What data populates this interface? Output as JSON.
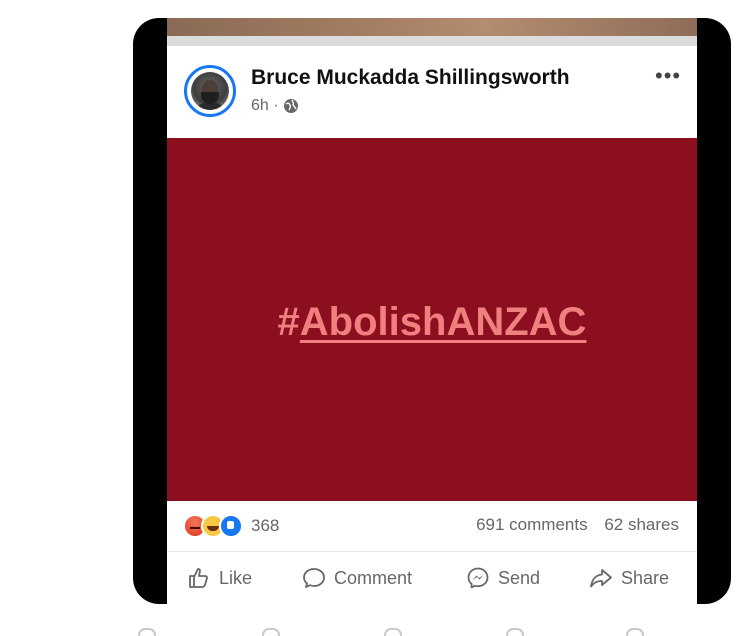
{
  "post": {
    "author": "Bruce Muckadda Shillingsworth",
    "time": "6h ·",
    "hashtag": "#AbolishANZAC",
    "hashtag_symbol": "#",
    "hashtag_text": "AbolishANZAC",
    "banner_color": "#8b0f1e",
    "hashtag_color": "#f08080",
    "more_label": "•••"
  },
  "stats": {
    "reactions_count": "368",
    "comments": "691 comments",
    "shares": "62 shares"
  },
  "actions": {
    "like": "Like",
    "comment": "Comment",
    "send": "Send",
    "share": "Share"
  },
  "icons": [
    "globe-icon",
    "more-icon",
    "like-icon",
    "comment-icon",
    "send-icon",
    "share-icon"
  ]
}
